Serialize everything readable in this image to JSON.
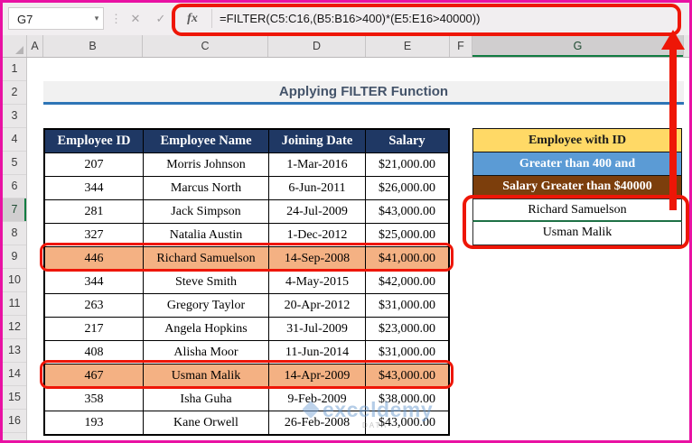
{
  "formula_bar": {
    "name_box": "G7",
    "formula": "=FILTER(C5:C16,(B5:B16>400)*(E5:E16>40000))",
    "fx": "fx",
    "cancel_glyph": "✕",
    "enter_glyph": "✓",
    "caret_glyph": "▾",
    "dots_glyph": "⋮"
  },
  "columns": [
    "A",
    "B",
    "C",
    "D",
    "E",
    "F",
    "G"
  ],
  "row_numbers": [
    "1",
    "2",
    "3",
    "4",
    "5",
    "6",
    "7",
    "8",
    "9",
    "10",
    "11",
    "12",
    "13",
    "14",
    "15",
    "16"
  ],
  "selection": {
    "cell": "G7",
    "column": "G",
    "row": "7"
  },
  "title_banner": "Applying FILTER Function",
  "employee_table": {
    "headers": [
      "Employee ID",
      "Employee Name",
      "Joining Date",
      "Salary"
    ],
    "rows": [
      [
        "207",
        "Morris Johnson",
        "1-Mar-2016",
        "$21,000.00"
      ],
      [
        "344",
        "Marcus North",
        "6-Jun-2011",
        "$26,000.00"
      ],
      [
        "281",
        "Jack Simpson",
        "24-Jul-2009",
        "$43,000.00"
      ],
      [
        "327",
        "Natalia Austin",
        "1-Dec-2012",
        "$25,000.00"
      ],
      [
        "446",
        "Richard Samuelson",
        "14-Sep-2008",
        "$41,000.00"
      ],
      [
        "344",
        "Steve Smith",
        "4-May-2015",
        "$42,000.00"
      ],
      [
        "263",
        "Gregory Taylor",
        "20-Apr-2012",
        "$31,000.00"
      ],
      [
        "217",
        "Angela Hopkins",
        "31-Jul-2009",
        "$23,000.00"
      ],
      [
        "408",
        "Alisha Moor",
        "11-Jun-2014",
        "$31,000.00"
      ],
      [
        "467",
        "Usman Malik",
        "14-Apr-2009",
        "$43,000.00"
      ],
      [
        "358",
        "Isha Guha",
        "9-Feb-2009",
        "$38,000.00"
      ],
      [
        "193",
        "Kane Orwell",
        "26-Feb-2008",
        "$43,000.00"
      ]
    ],
    "highlighted_row_indexes": [
      4,
      9
    ]
  },
  "result_panel": {
    "header_rows": [
      {
        "text": "Employee with ID",
        "bg": "#FFD966",
        "fg": "#1a1a1a"
      },
      {
        "text": "Greater than 400 and",
        "bg": "#5B9BD5",
        "fg": "#ffffff"
      },
      {
        "text": "Salary Greater than $40000",
        "bg": "#7C3E0C",
        "fg": "#ffffff"
      }
    ],
    "results": [
      "Richard Samuelson",
      "Usman Malik"
    ]
  },
  "watermark": {
    "brand": "exceldemy",
    "sub": "DATA"
  },
  "colors": {
    "frame_pink": "#E911A3",
    "annotation_red": "#EE1607",
    "table_header_navy": "#1F3864",
    "highlight_orange": "#F4B183",
    "title_text": "#44546A",
    "title_underline": "#2E75B6",
    "excel_green": "#107C41",
    "selection_green": "#1E7145"
  }
}
